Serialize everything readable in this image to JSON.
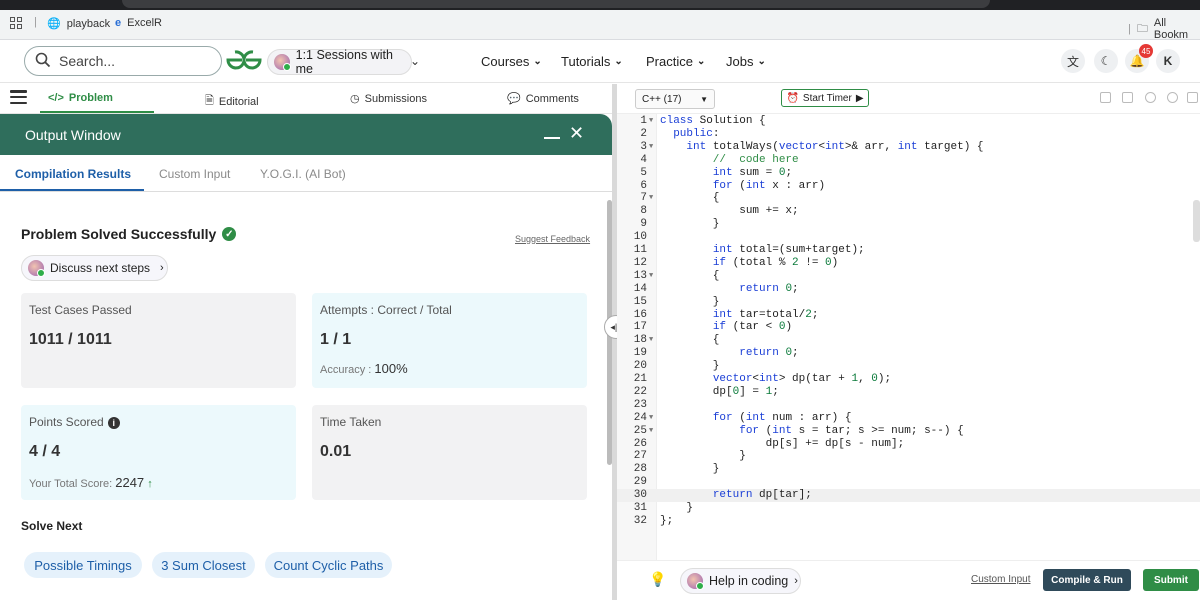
{
  "browser": {
    "bookmarks": [
      {
        "label": "playback"
      },
      {
        "label": "ExcelR"
      }
    ],
    "all_bookmarks": "All Bookm"
  },
  "header": {
    "search_placeholder": "Search...",
    "logo": "GG",
    "sessions_label": "1:1 Sessions with me",
    "nav": [
      "Courses",
      "Tutorials",
      "Practice",
      "Jobs"
    ],
    "notification_count": "45",
    "user_initial": "K"
  },
  "left_tabs": [
    "Problem",
    "Editorial",
    "Submissions",
    "Comments"
  ],
  "output_window": {
    "title": "Output Window",
    "tabs": [
      "Compilation Results",
      "Custom Input",
      "Y.O.G.I. (AI Bot)"
    ],
    "status": "Problem Solved Successfully",
    "suggest_feedback": "Suggest Feedback",
    "discuss_next": "Discuss next steps",
    "cards": {
      "test_cases": {
        "label": "Test Cases Passed",
        "value": "1011 / 1011"
      },
      "attempts": {
        "label": "Attempts : Correct / Total",
        "value": "1 / 1",
        "accuracy_label": "Accuracy :",
        "accuracy_value": "100%"
      },
      "points": {
        "label": "Points Scored",
        "value": "4 / 4",
        "total_label": "Your Total Score:",
        "total_value": "2247"
      },
      "time": {
        "label": "Time Taken",
        "value": "0.01"
      }
    },
    "solve_next_title": "Solve Next",
    "solve_next": [
      "Possible Timings",
      "3 Sum Closest",
      "Count Cyclic Paths"
    ]
  },
  "editor": {
    "language": "C++ (17)",
    "start_timer": "Start Timer",
    "highlighted_line": 30,
    "lines": [
      "class Solution {",
      "  public:",
      "    int totalWays(vector<int>& arr, int target) {",
      "        //  code here",
      "        int sum = 0;",
      "        for (int x : arr)",
      "        {",
      "            sum += x;",
      "        }",
      "",
      "        int total=(sum+target);",
      "        if (total % 2 != 0)",
      "        {",
      "            return 0;",
      "        }",
      "        int tar=total/2;",
      "        if (tar < 0)",
      "        {",
      "            return 0;",
      "        }",
      "        vector<int> dp(tar + 1, 0);",
      "        dp[0] = 1;",
      "",
      "        for (int num : arr) {",
      "            for (int s = tar; s >= num; s--) {",
      "                dp[s] += dp[s - num];",
      "            }",
      "        }",
      "",
      "        return dp[tar];",
      "    }",
      "};"
    ],
    "fold_lines": [
      1,
      3,
      7,
      13,
      18,
      24,
      25
    ]
  },
  "bottom": {
    "help_coding": "Help in coding",
    "custom_input": "Custom Input",
    "compile_run": "Compile & Run",
    "submit": "Submit"
  }
}
